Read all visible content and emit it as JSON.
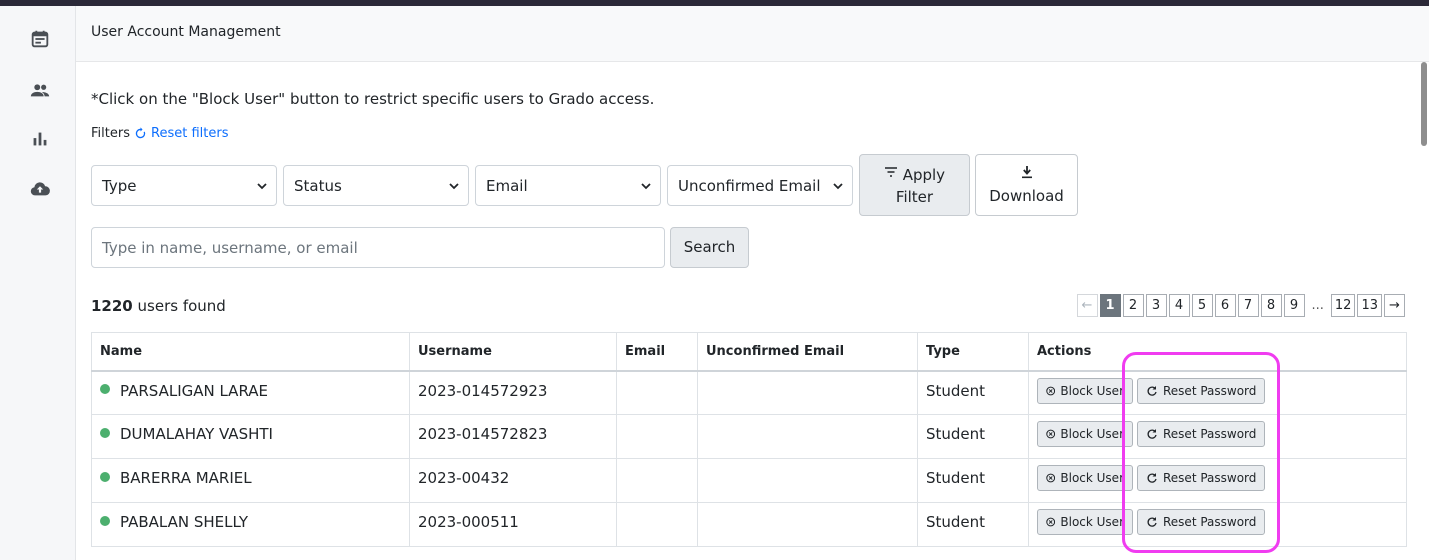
{
  "header": {
    "title": "User Account Management"
  },
  "sidebar": {
    "icons": [
      "calendar-icon",
      "users-icon",
      "bar-chart-icon",
      "cloud-upload-icon"
    ]
  },
  "instruction": "*Click on the \"Block User\" button to restrict specific users to Grado access.",
  "filters": {
    "label": "Filters",
    "reset_label": "Reset filters",
    "selects": [
      "Type",
      "Status",
      "Email",
      "Unconfirmed Email"
    ],
    "apply_line1": "Apply",
    "apply_line2": "Filter",
    "download_label": "Download"
  },
  "search": {
    "placeholder": "Type in name, username, or email",
    "button_label": "Search"
  },
  "results": {
    "count": "1220",
    "suffix": " users found"
  },
  "pagination": {
    "prev": "←",
    "next": "→",
    "pages": [
      "1",
      "2",
      "3",
      "4",
      "5",
      "6",
      "7",
      "8",
      "9"
    ],
    "ellipsis": "...",
    "tail": [
      "12",
      "13"
    ],
    "current": "1"
  },
  "table": {
    "columns": [
      "Name",
      "Username",
      "Email",
      "Unconfirmed Email",
      "Type",
      "Actions"
    ],
    "rows": [
      {
        "name": "PARSALIGAN LARAE",
        "username": "2023-014572923",
        "email": "",
        "unconfirmed": "",
        "type": "Student"
      },
      {
        "name": "DUMALAHAY VASHTI",
        "username": "2023-014572823",
        "email": "",
        "unconfirmed": "",
        "type": "Student"
      },
      {
        "name": "BARERRA MARIEL",
        "username": "2023-00432",
        "email": "",
        "unconfirmed": "",
        "type": "Student"
      },
      {
        "name": "PABALAN SHELLY",
        "username": "2023-000511",
        "email": "",
        "unconfirmed": "",
        "type": "Student"
      }
    ],
    "block_label": "Block User",
    "reset_label": "Reset Password"
  },
  "colors": {
    "active_dot": "#4caf6e",
    "annotation": "#f03cf0",
    "link": "#0d6efd"
  }
}
